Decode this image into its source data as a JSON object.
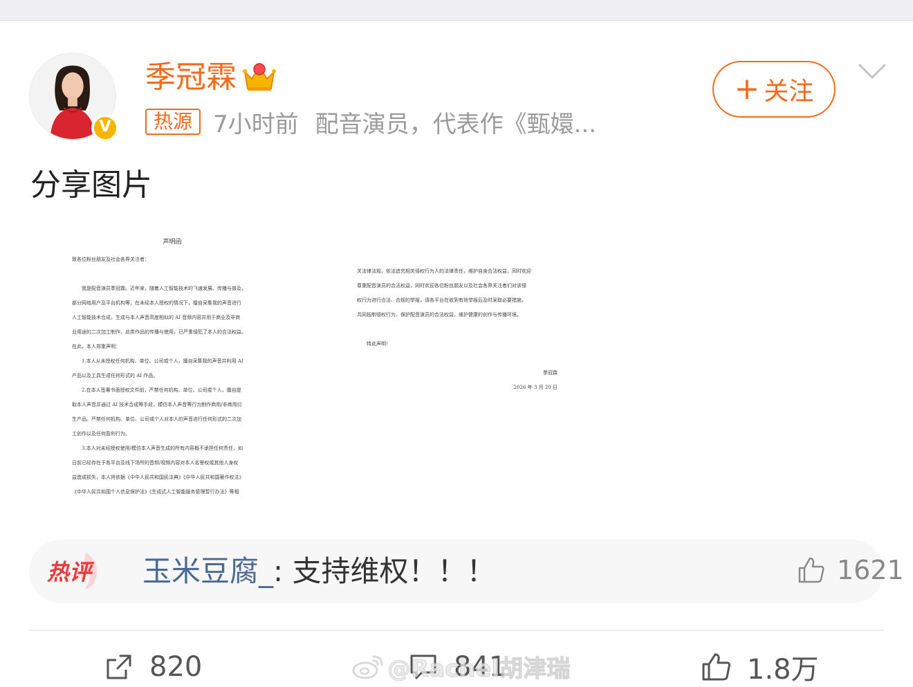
{
  "post": {
    "author": {
      "name": "季冠霖",
      "verified_badge": "V",
      "crown_icon": "crown-icon",
      "accent_color": "#f26a1b"
    },
    "source_tag": "热源",
    "time": "7小时前",
    "description": "配音演员，代表作《甄嬛...",
    "follow_button": {
      "plus": "+",
      "label": "关注"
    },
    "text": "分享图片",
    "image": {
      "title": "声明函",
      "left_lines": [
        "致各位粉丝朋友及社会各界关注者：",
        "",
        "我是配音演员季冠霖。近年来，随着人工智能技术的飞速发展、传播与普及，",
        "部分网络用户及平台机构等，在未经本人授权的情况下，擅自采集我的声音进行",
        "人工智能技术合成，生成与本人声音高度相似的 AI 音频内容并用于商业及非商",
        "业用途的二次加工制作，此类作品的传播与使用，已严重侵犯了本人的合法权益。",
        "在此，本人郑重声明：",
        "1.本人从未授权任何机构、单位、公司或个人，擅自采集我的声音并利用 AI",
        "产品以及工具生成任何形式的 AI 作品。",
        "2.在本人签署书面授权文件前，严禁任何机构、单位、公司或个人，擅自提",
        "取本人声音并通过 AI 技术合成等手段，模仿本人声音等行为制作商用/非商用衍",
        "生产品。严禁任何机构、单位、公司或个人对本人的声音进行任何形式的二次加",
        "工创作以及任何盈利行为。",
        "3.本人对未经授权使用/模仿本人声音生成的所有内容概不承担任何责任，如",
        "日前已经存在于各平台及线下场所的音频/视频内容对本人名誉权或其他人身权",
        "益造成损失，本人将依据《中华人民共和国民法典》《中华人民共和国著作权法》",
        "《中华人民共和国个人信息保护法》《生成式人工智能服务管理暂行办法》等相"
      ],
      "right_lines": [
        "关法律法规，依法追究相关侵权行为人的法律责任，维护自身合法权益，同时欢迎",
        "尊重配音演员的合法权益，同时欢迎各位粉丝朋友以及社会各界关注者们对该侵",
        "权行为进行合法、合规的举报，请各平台在收到有效举报后及时采取必要措施，",
        "共同抵制侵权行为，保护配音演员的合法权益，维护健康的创作与传播环境。"
      ],
      "closing": "特此声明！",
      "signature": "季冠霖",
      "date": "2026 年 3 月 20 日"
    },
    "hot_comment": {
      "badge": "热评",
      "user": "玉米豆腐_",
      "separator": ":",
      "text": "支持维权！！！",
      "likes": "1621"
    },
    "actions": {
      "share_count": "820",
      "comment_count": "841",
      "like_count": "1.8万"
    },
    "watermark": "@Rachel胡津瑞"
  }
}
